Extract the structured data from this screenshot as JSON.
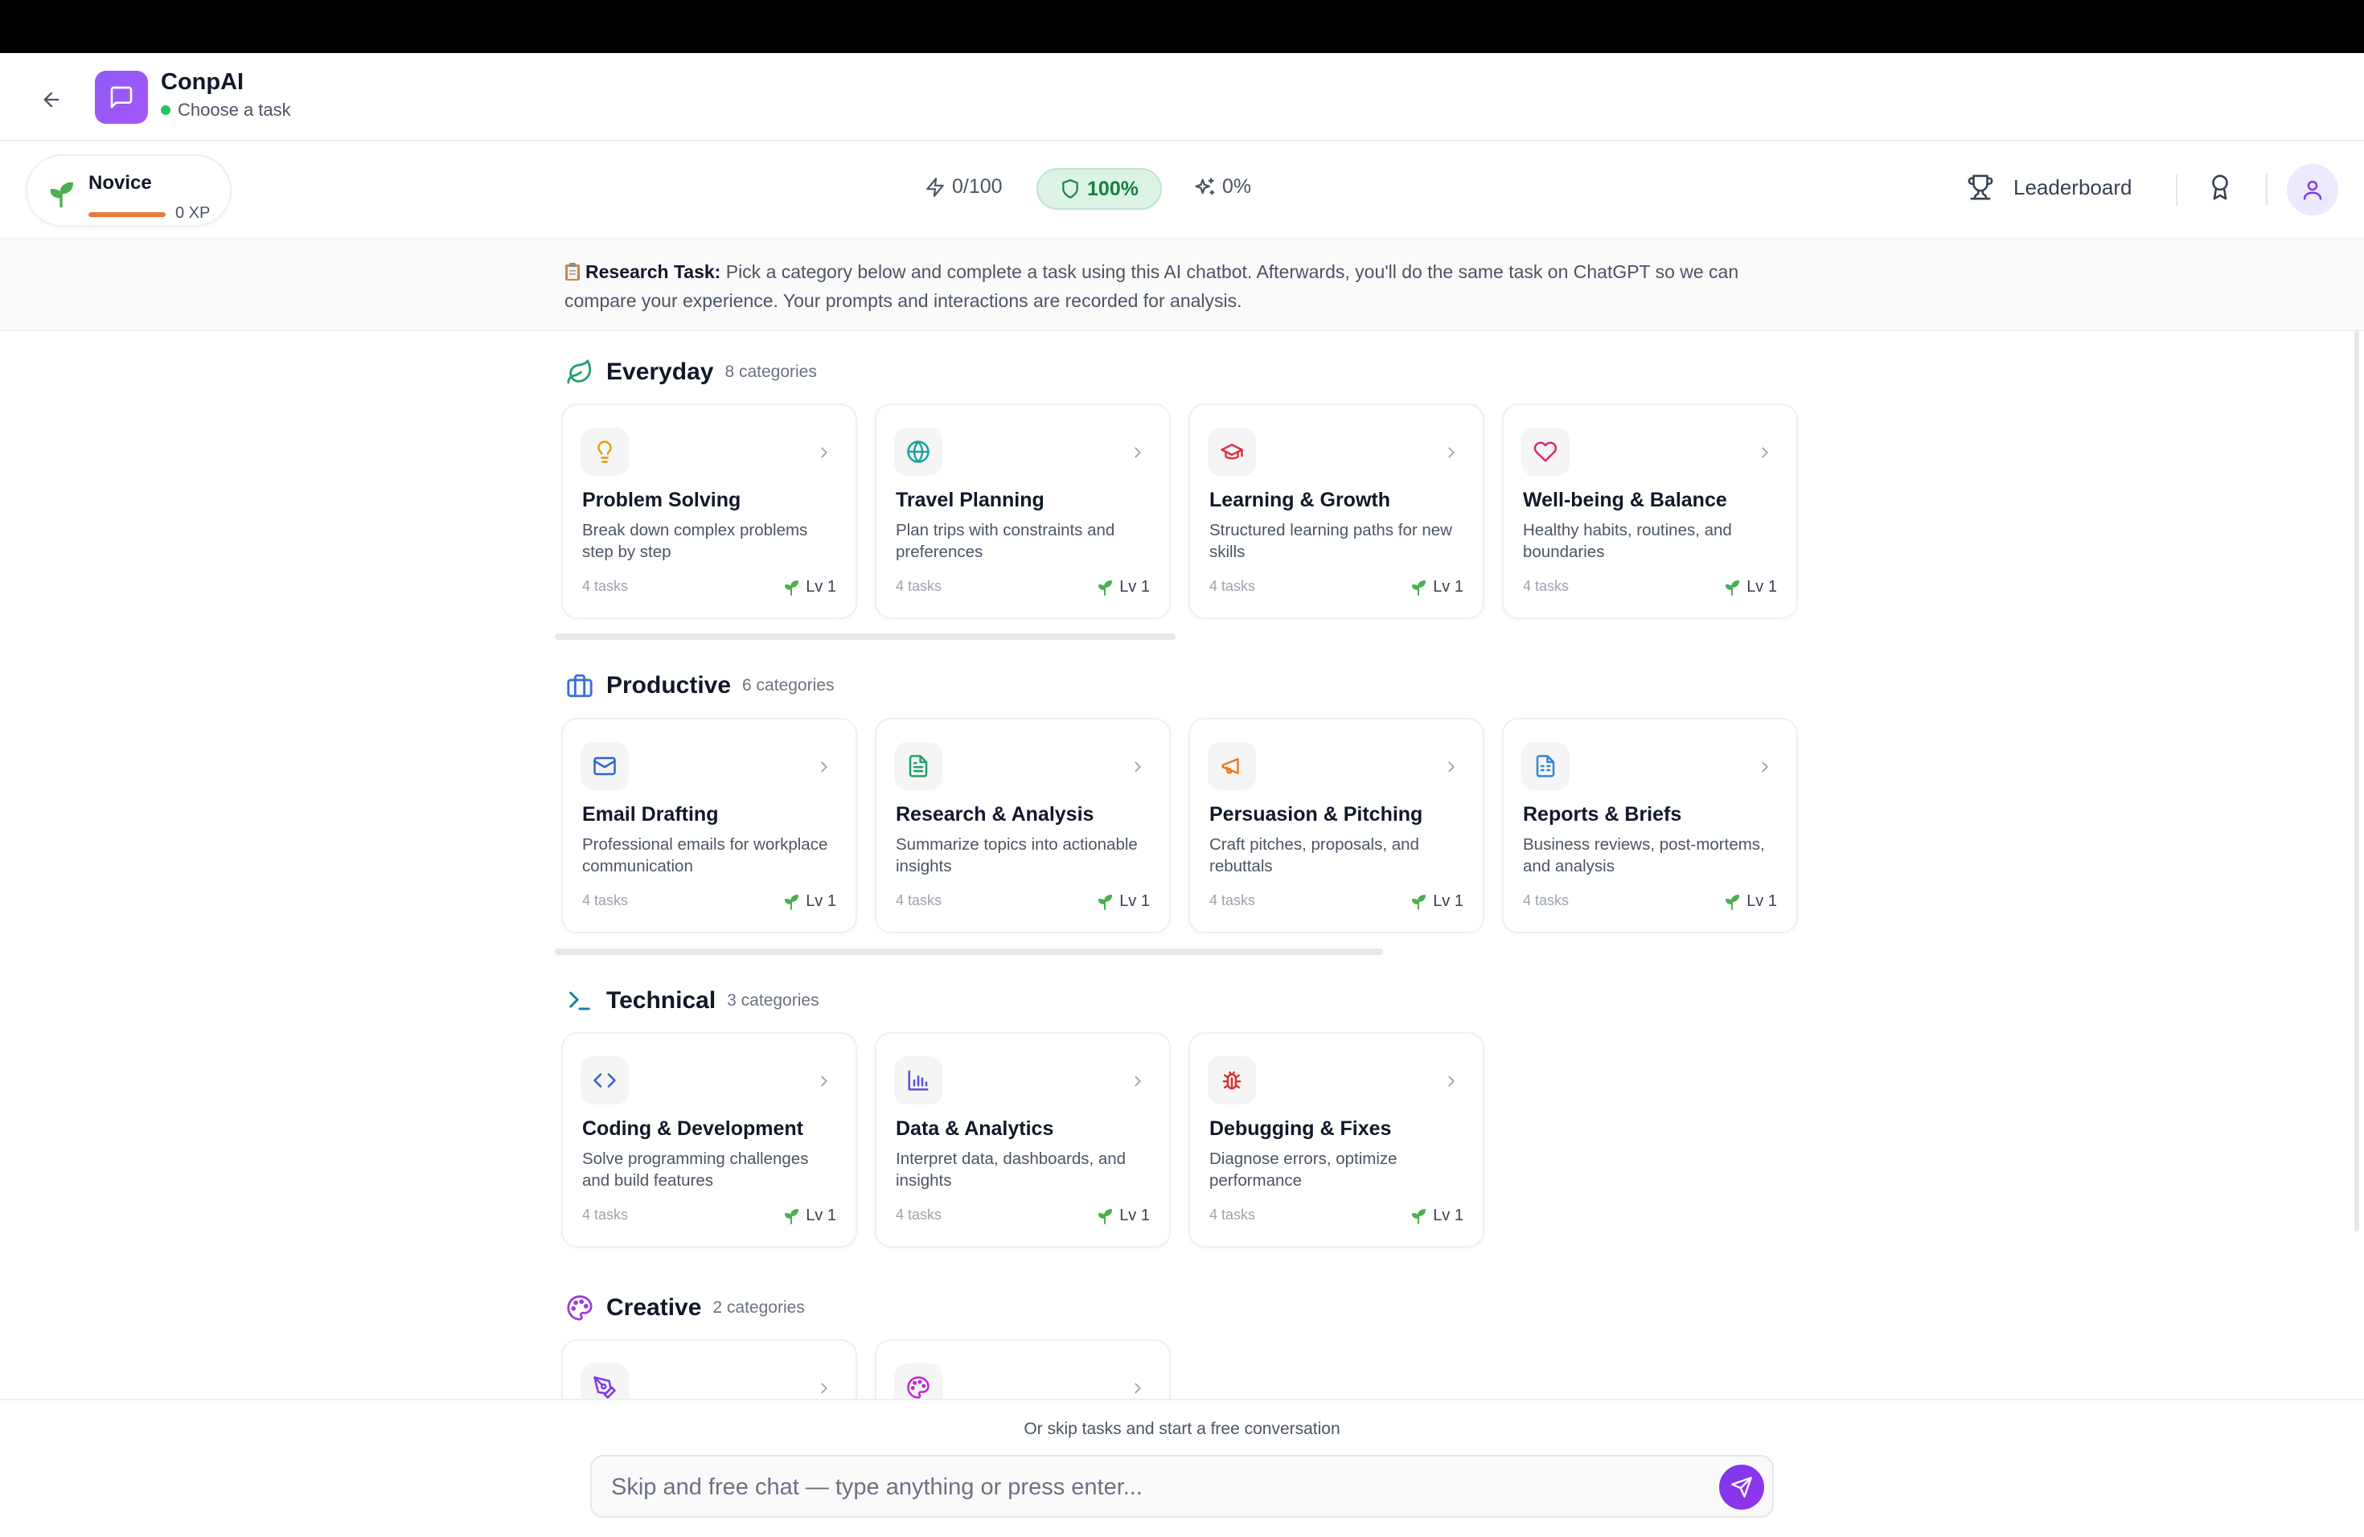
{
  "app": {
    "title": "ConpAI",
    "status": "Choose a task"
  },
  "stats": {
    "level_name": "Novice",
    "xp": "0 XP",
    "xp_progress": 1.0,
    "energy": "0/100",
    "shield": "100%",
    "spark": "0%",
    "leaderboard_label": "Leaderboard"
  },
  "notice": {
    "label": "Research Task:",
    "text": "Pick a category below and complete a task using this AI chatbot. Afterwards, you'll do the same task on ChatGPT so we can compare your experience. Your prompts and interactions are recorded for analysis."
  },
  "sections": [
    {
      "title": "Everyday",
      "count": "8 categories",
      "cards": [
        {
          "title": "Problem Solving",
          "desc": "Break down complex problems step by step",
          "tasks": "4 tasks",
          "level": "Lv 1",
          "icon": "lightbulb-icon"
        },
        {
          "title": "Travel Planning",
          "desc": "Plan trips with constraints and preferences",
          "tasks": "4 tasks",
          "level": "Lv 1",
          "icon": "globe-icon"
        },
        {
          "title": "Learning & Growth",
          "desc": "Structured learning paths for new skills",
          "tasks": "4 tasks",
          "level": "Lv 1",
          "icon": "graduation-cap-icon"
        },
        {
          "title": "Well-being & Balance",
          "desc": "Healthy habits, routines, and boundaries",
          "tasks": "4 tasks",
          "level": "Lv 1",
          "icon": "heart-icon"
        }
      ]
    },
    {
      "title": "Productive",
      "count": "6 categories",
      "cards": [
        {
          "title": "Email Drafting",
          "desc": "Professional emails for workplace communication",
          "tasks": "4 tasks",
          "level": "Lv 1",
          "icon": "mail-icon"
        },
        {
          "title": "Research & Analysis",
          "desc": "Summarize topics into actionable insights",
          "tasks": "4 tasks",
          "level": "Lv 1",
          "icon": "document-icon"
        },
        {
          "title": "Persuasion & Pitching",
          "desc": "Craft pitches, proposals, and rebuttals",
          "tasks": "4 tasks",
          "level": "Lv 1",
          "icon": "megaphone-icon"
        },
        {
          "title": "Reports & Briefs",
          "desc": "Business reviews, post-mortems, and analysis",
          "tasks": "4 tasks",
          "level": "Lv 1",
          "icon": "report-icon"
        }
      ]
    },
    {
      "title": "Technical",
      "count": "3 categories",
      "cards": [
        {
          "title": "Coding & Development",
          "desc": "Solve programming challenges and build features",
          "tasks": "4 tasks",
          "level": "Lv 1",
          "icon": "code-icon"
        },
        {
          "title": "Data & Analytics",
          "desc": "Interpret data, dashboards, and insights",
          "tasks": "4 tasks",
          "level": "Lv 1",
          "icon": "bar-chart-icon"
        },
        {
          "title": "Debugging & Fixes",
          "desc": "Diagnose errors, optimize performance",
          "tasks": "4 tasks",
          "level": "Lv 1",
          "icon": "bug-icon"
        }
      ]
    },
    {
      "title": "Creative",
      "count": "2 categories",
      "cards": [
        {
          "icon": "pen-tool-icon"
        },
        {
          "icon": "palette-icon"
        }
      ]
    }
  ],
  "chat": {
    "hint": "Or skip tasks and start a free conversation",
    "placeholder": "Skip and free chat — type anything or press enter..."
  },
  "colors": {
    "accent": "#8b5cf6",
    "xp_bar": "#ea7a37",
    "shield_bg": "#dcf3e6",
    "shield_text": "#15803d",
    "level_leaf": "#4caf50"
  }
}
